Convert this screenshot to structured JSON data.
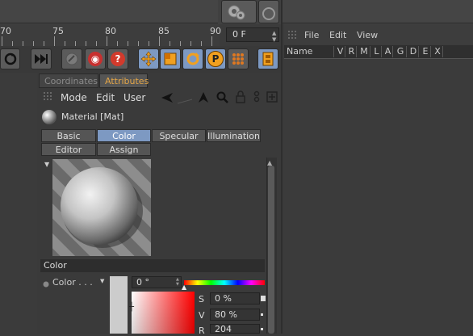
{
  "timeline": {
    "ticks": [
      "70",
      "75",
      "80",
      "85",
      "90"
    ],
    "frame_value": "0 F"
  },
  "attributes": {
    "tabs": {
      "coordinates": "Coordinates",
      "attributes": "Attributes"
    },
    "menu": {
      "mode": "Mode",
      "edit": "Edit",
      "user": "User"
    },
    "material_title": "Material [Mat]",
    "channel_buttons": {
      "basic": "Basic",
      "color": "Color",
      "specular": "Specular",
      "illumination": "Illumination",
      "editor": "Editor",
      "assign": "Assign"
    },
    "section_title": "Color",
    "color_label": "Color . . .",
    "hue_value": "0 °",
    "fields": {
      "s_label": "S",
      "s_value": "0 %",
      "v_label": "V",
      "v_value": "80 %",
      "r_label": "R",
      "r_value": "204"
    }
  },
  "manager": {
    "menu": {
      "file": "File",
      "edit": "Edit",
      "view": "View"
    },
    "columns": [
      "Name",
      "V",
      "R",
      "M",
      "L",
      "A",
      "G",
      "D",
      "E",
      "X"
    ]
  },
  "colors": {
    "accent_tab": "#e4a648",
    "selected_button": "#7d99c2",
    "panel_bg": "#3a3a3a"
  }
}
